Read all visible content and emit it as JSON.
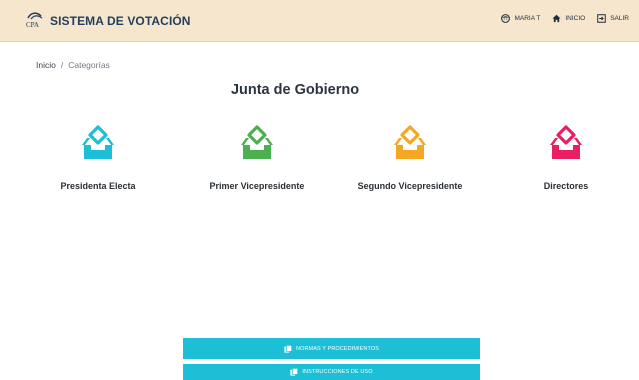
{
  "header": {
    "logo_text": "CPA",
    "app_title": "SISTEMA DE VOTACIÓN",
    "nav": [
      {
        "label": "MARIA T",
        "icon": "user-face-icon"
      },
      {
        "label": "INICIO",
        "icon": "home-icon"
      },
      {
        "label": "SALIR",
        "icon": "logout-icon"
      }
    ]
  },
  "breadcrumb": {
    "home": "Inicio",
    "separator": "/",
    "current": "Categorías"
  },
  "page_title": "Junta de Gobierno",
  "categories": [
    {
      "label": "Presidenta Electa",
      "color": "#1cbfd6",
      "icon": "ballot-box-icon"
    },
    {
      "label": "Primer Vicepresidente",
      "color": "#4caf50",
      "icon": "ballot-box-icon"
    },
    {
      "label": "Segundo Vicepresidente",
      "color": "#f5a623",
      "icon": "ballot-box-icon"
    },
    {
      "label": "Directores",
      "color": "#e91e63",
      "icon": "ballot-box-icon"
    }
  ],
  "buttons": {
    "norms": "NORMAS Y PROCEDIMIENTOS",
    "instructions": "INSTRUCCIONES DE USO"
  },
  "colors": {
    "header_bg": "#f6e6cd",
    "button_bg": "#1cbfd6",
    "brand_text": "#1f3f5b"
  }
}
